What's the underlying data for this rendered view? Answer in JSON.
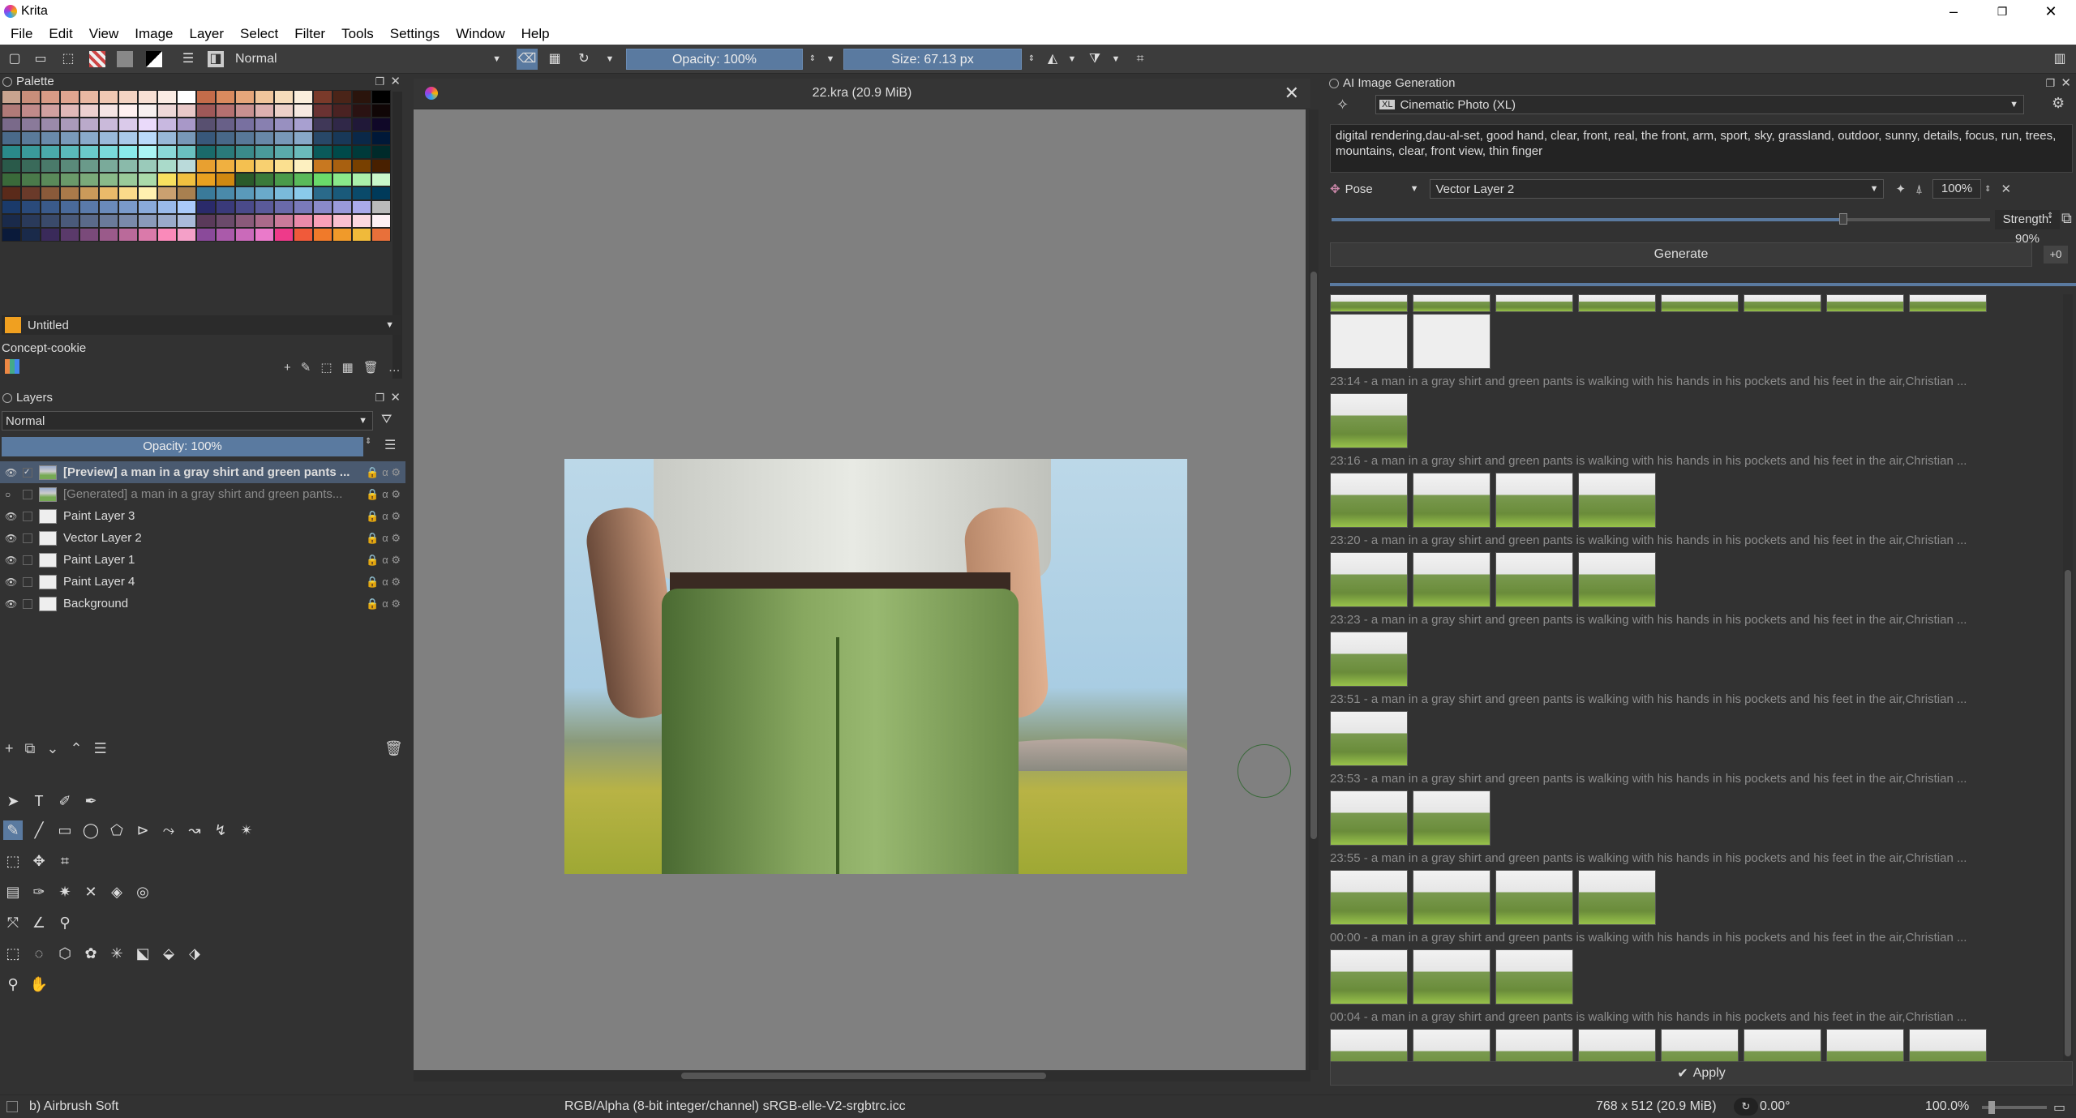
{
  "window": {
    "title": "Krita"
  },
  "menu": [
    "File",
    "Edit",
    "View",
    "Image",
    "Layer",
    "Select",
    "Filter",
    "Tools",
    "Settings",
    "Window",
    "Help"
  ],
  "toolbar": {
    "blend_mode": "Normal",
    "opacity": "Opacity: 100%",
    "size": "Size: 67.13 px"
  },
  "palette": {
    "title": "Palette",
    "colors": [
      "#c9a48f",
      "#c88e7a",
      "#d89b86",
      "#e0a590",
      "#e9b8a2",
      "#f0c8b3",
      "#f4d3c2",
      "#f8e0d4",
      "#fbece4",
      "#ffffff",
      "#c46c4a",
      "#d98a5e",
      "#e6a67a",
      "#f0c59b",
      "#f6dcba",
      "#fbeedc",
      "#7a3a2a",
      "#4a2418",
      "#2a140c",
      "#000000",
      "#b07a78",
      "#c08a8a",
      "#d0a0a0",
      "#e0b8b8",
      "#ecd0d0",
      "#f4e4e4",
      "#fff0f0",
      "#f8f0f0",
      "#eed8d8",
      "#e8c8c8",
      "#9e5858",
      "#b47070",
      "#c89090",
      "#dcb0b0",
      "#ecd0c8",
      "#f6e8e0",
      "#6a3232",
      "#4a2222",
      "#2a1212",
      "#100606",
      "#7a6a8a",
      "#8a7a9a",
      "#9a8aaa",
      "#aa9aba",
      "#baaaca",
      "#cabada",
      "#dacaea",
      "#eadafa",
      "#c8b8e0",
      "#a898c8",
      "#585070",
      "#686088",
      "#7870a0",
      "#8880b0",
      "#9890c0",
      "#a8a0d0",
      "#403858",
      "#302848",
      "#201838",
      "#100828",
      "#4a6a8a",
      "#5a7a9a",
      "#6a8aaa",
      "#7a9aba",
      "#8aaaca",
      "#9abada",
      "#aacaea",
      "#badafa",
      "#98b8d8",
      "#7898b8",
      "#38587a",
      "#486888",
      "#587898",
      "#6888a8",
      "#7898b8",
      "#88a8c8",
      "#284868",
      "#183858",
      "#0a2848",
      "#001838",
      "#2a8a8a",
      "#3a9a9a",
      "#4aaaaa",
      "#5ababa",
      "#6acaca",
      "#7adada",
      "#8aeaea",
      "#aaf4f4",
      "#8ad8d8",
      "#6ac0c0",
      "#1a6a6a",
      "#2a7a7a",
      "#3a8a8a",
      "#4a9a9a",
      "#5aaaaa",
      "#6ababa",
      "#0a5a5a",
      "#004a4a",
      "#003a3a",
      "#002a2a",
      "#2a5a4a",
      "#3a6a5a",
      "#4a7a6a",
      "#5a8a7a",
      "#6a9a8a",
      "#7aaa9a",
      "#8abaaa",
      "#9acaba",
      "#aadaca",
      "#badada",
      "#e8a030",
      "#f0b040",
      "#f4c050",
      "#f8d070",
      "#fbe090",
      "#fdf0c0",
      "#c87820",
      "#a86010",
      "#784000",
      "#482000",
      "#3a6a3a",
      "#4a7a4a",
      "#5a8a5a",
      "#6a9a6a",
      "#7aaa7a",
      "#8aba8a",
      "#9aca9a",
      "#aadaaa",
      "#f8e060",
      "#f0c040",
      "#e8a020",
      "#d08810",
      "#2a5a2a",
      "#3a7a3a",
      "#4a9a4a",
      "#5aba5a",
      "#6ada6a",
      "#8ae88a",
      "#aaf0aa",
      "#caf8ca",
      "#5a2a1a",
      "#6a3a2a",
      "#8a5a3a",
      "#aa7a4a",
      "#ca9a5a",
      "#eaba6a",
      "#fada8a",
      "#fff0b0",
      "#caa070",
      "#a88050",
      "#3a7a9a",
      "#4a8aaa",
      "#5a9aba",
      "#6aaaca",
      "#7abada",
      "#8acaea",
      "#2a6a8a",
      "#1a5a7a",
      "#0a4a6a",
      "#003a5a",
      "#1a3a6a",
      "#2a4a7a",
      "#3a5a8a",
      "#4a6a9a",
      "#5a7aaa",
      "#6a8aba",
      "#7a9aca",
      "#8aaada",
      "#9abaea",
      "#aacafa",
      "#2a2a6a",
      "#3a3a7a",
      "#4a4a8a",
      "#5a5a9a",
      "#6a6aaa",
      "#7a7aba",
      "#8a8aca",
      "#9a9ada",
      "#aaaaea",
      "#bababa",
      "#1a2a4a",
      "#2a3a5a",
      "#3a4a6a",
      "#4a5a7a",
      "#5a6a8a",
      "#6a7a9a",
      "#7a8aaa",
      "#8a9aba",
      "#9aaaca",
      "#aabada",
      "#5a3a5a",
      "#6a4a6a",
      "#8a5a7a",
      "#aa6a8a",
      "#ca7a9a",
      "#ea8aaa",
      "#f8a0b8",
      "#fac0d0",
      "#fcd8e0",
      "#fef0f4",
      "#0a1a3a",
      "#1a2a4a",
      "#3a2a5a",
      "#5a3a6a",
      "#7a4a7a",
      "#9a5a8a",
      "#ba6a9a",
      "#da7aaa",
      "#fa8aba",
      "#f4a0c8",
      "#8a4a9a",
      "#aa5aaa",
      "#ca6aba",
      "#ea7aca",
      "#ee3a8a",
      "#f05a3a",
      "#f07a2a",
      "#f09a2a",
      "#f0ba3a",
      "#e8703a"
    ],
    "current_swatch_label": "Untitled",
    "current_swatch_color": "#f0a020",
    "concept_label": "Concept-cookie"
  },
  "layers": {
    "title": "Layers",
    "blend_mode": "Normal",
    "opacity": "Opacity:  100%",
    "items": [
      {
        "name": "[Preview] a man in a gray shirt and green pants ...",
        "selected": true
      },
      {
        "name": "[Generated] a man in a gray shirt and green pants...",
        "dim": true
      },
      {
        "name": "Paint Layer 3"
      },
      {
        "name": "Vector Layer 2"
      },
      {
        "name": "Paint Layer 1"
      },
      {
        "name": "Paint Layer 4"
      },
      {
        "name": "Background"
      }
    ]
  },
  "canvas": {
    "tab_title": "22.kra (20.9 MiB)"
  },
  "ai": {
    "title": "AI Image Generation",
    "style": "Cinematic Photo (XL)",
    "prompt": "digital rendering,dau-al-set, good hand, clear, front, real, the front, arm, sport, sky, grassland, outdoor, sunny, details, focus, run, trees, mountains, clear, front view, thin finger",
    "control_mode": "Pose",
    "control_layer": "Vector Layer 2",
    "control_strength_pct": "100%",
    "strength": "Strength: 90%",
    "generate": "Generate",
    "seed_btn": "+0",
    "apply": "Apply",
    "history_label": "a man in a gray shirt and green pants is walking with his hands in his pockets and his feet in the air,Christian ...",
    "history": [
      {
        "time": "23:14",
        "count": 1
      },
      {
        "time": "23:16",
        "count": 4
      },
      {
        "time": "23:20",
        "count": 4
      },
      {
        "time": "23:23",
        "count": 1
      },
      {
        "time": "23:51",
        "count": 1
      },
      {
        "time": "23:53",
        "count": 2
      },
      {
        "time": "23:55",
        "count": 4
      },
      {
        "time": "00:00",
        "count": 3
      },
      {
        "time": "00:04",
        "count": 8
      }
    ]
  },
  "status": {
    "brush": "b) Airbrush Soft",
    "colorspace": "RGB/Alpha (8-bit integer/channel)  sRGB-elle-V2-srgbtrc.icc",
    "dimensions": "768 x 512 (20.9 MiB)",
    "rotation": "0.00°",
    "zoom": "100.0%"
  }
}
